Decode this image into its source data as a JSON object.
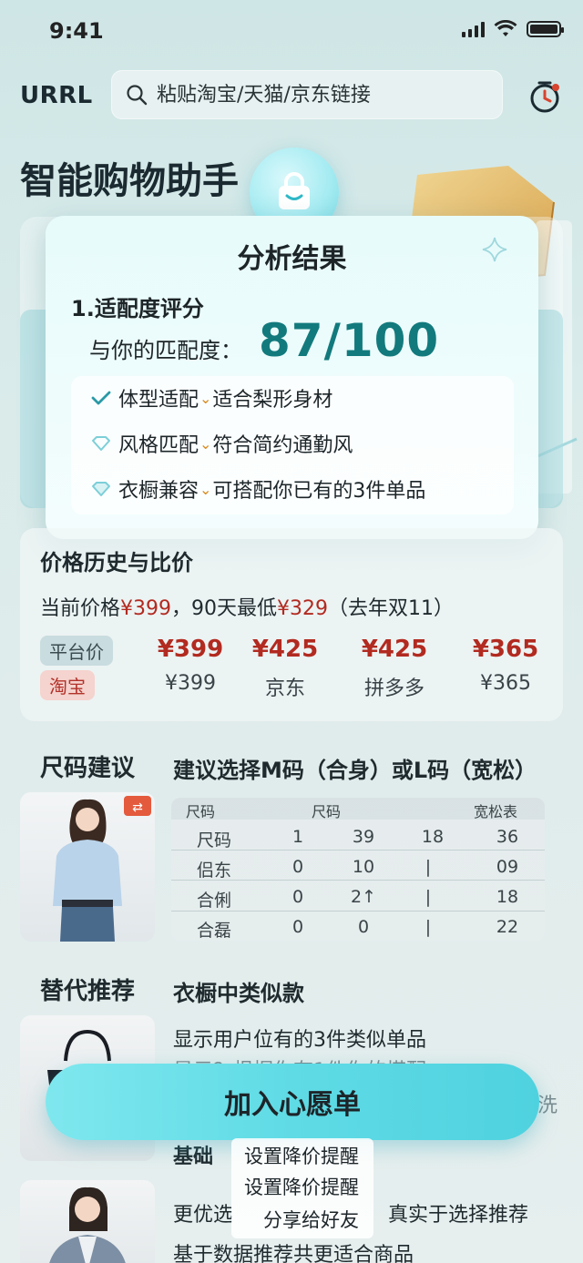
{
  "status_bar": {
    "time": "9:41"
  },
  "header": {
    "logo": "URRL",
    "search_placeholder": "粘贴淘宝/天猫/京东链接",
    "icons": [
      "search-icon",
      "timer-icon"
    ]
  },
  "page_title": "智能购物助手",
  "modal": {
    "title": "分析结果",
    "section1_title": "1.适配度评分",
    "match_label": "与你的匹配度：",
    "match_score": "87/100",
    "checks": [
      {
        "part1": "体型适配",
        "part2": "适合梨形身材",
        "icon": "check-icon"
      },
      {
        "part1": "风格匹配",
        "part2": "符合简约通勤风",
        "icon": "heart-outline-icon"
      },
      {
        "part1": "衣橱兼容",
        "part2": "可搭配你已有的3件单品",
        "icon": "heart-outline-icon"
      }
    ]
  },
  "price": {
    "title": "价格历史与比价",
    "line_prefix": "当前价格",
    "current": "¥399",
    "line_mid": "，90天最低",
    "lowest": "¥329",
    "line_suffix": "（去年双11）",
    "tag_avg": "平台价",
    "tag_taobao": "淘宝",
    "columns": [
      {
        "top": "¥399",
        "bottom": "¥399"
      },
      {
        "top": "¥425",
        "bottom": "京东"
      },
      {
        "top": "¥425",
        "bottom": "拼多多"
      },
      {
        "top": "¥365",
        "bottom": "¥365"
      }
    ]
  },
  "size": {
    "title": "尺码建议",
    "recommendation": "建议选择M码（合身）或L码（宽松）",
    "table_header": [
      "尺码",
      "尺码",
      "宽松表"
    ],
    "rows": [
      [
        "尺码",
        "1",
        "39",
        "18",
        "36"
      ],
      [
        "侣东",
        "0",
        "10",
        "|",
        "09"
      ],
      [
        "合俐",
        "0",
        "2↑",
        "|",
        "18"
      ],
      [
        "合磊",
        "0",
        "0",
        "|",
        "22"
      ]
    ]
  },
  "alternatives": {
    "title": "替代推荐",
    "subtitle": "衣橱中类似款",
    "desc": "显示用户位有的3件类似单品",
    "desc_faded": "显示？根据你有1件你的搭配",
    "faded_right": "洗",
    "base": "基础"
  },
  "wishlist_button": "加入心愿单",
  "menu": [
    "设置降价提醒",
    "设置降价提醒",
    "分享给好友"
  ],
  "recommend": {
    "line1a": "更优选",
    "line1b": "真实于选择推荐",
    "line2": "基于数据推荐共更适合商品"
  },
  "colors": {
    "accent": "#127a7d",
    "price_red": "#b22a20",
    "button": "#5fdbe5"
  }
}
